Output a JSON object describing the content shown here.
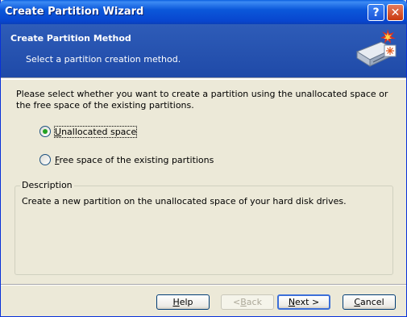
{
  "window": {
    "title": "Create Partition Wizard",
    "controls": {
      "help": "?",
      "close": "✕"
    }
  },
  "header": {
    "title": "Create Partition Method",
    "subtitle": "Select a partition creation method.",
    "icon": "wizard-disk-icon"
  },
  "body": {
    "instructions": "Please select whether you want to create a partition using the unallocated space or the free space of the existing partitions.",
    "options": [
      {
        "accel": "U",
        "rest": "nallocated space",
        "checked": true
      },
      {
        "accel": "F",
        "rest": "ree space of the existing partitions",
        "checked": false
      }
    ],
    "description_legend": "Description",
    "description_text": "Create a new partition on the unallocated space of your hard disk drives."
  },
  "buttons": {
    "help_accel": "H",
    "help_rest": "elp",
    "back_pre": "< ",
    "back_accel": "B",
    "back_rest": "ack",
    "next_accel": "N",
    "next_rest": "ext >",
    "cancel_accel": "C",
    "cancel_rest": "ancel"
  },
  "colors": {
    "titlebar": "#0B58DA",
    "header": "#2E5CB8",
    "dialog_bg": "#ECE9D8",
    "radio_check": "#21A121"
  }
}
